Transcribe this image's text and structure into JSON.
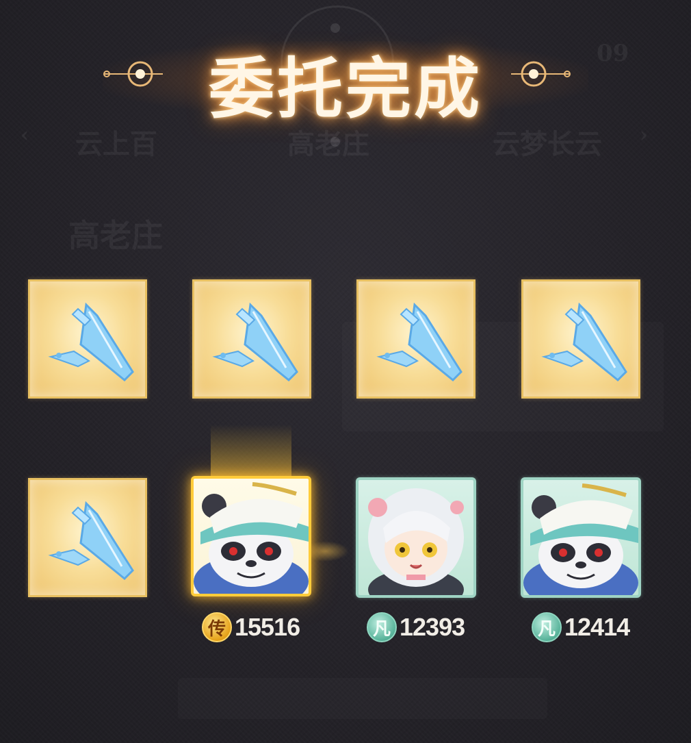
{
  "title": "委托完成",
  "background_ghost": {
    "counter": "09",
    "nav_left": "云上百",
    "nav_center": "高老庄",
    "nav_right": "云梦长云",
    "section": "高老庄"
  },
  "reward_items": [
    {
      "name": "crystal-fan-reward",
      "icon": "crystal-feather-icon"
    },
    {
      "name": "crystal-fan-reward",
      "icon": "crystal-feather-icon"
    },
    {
      "name": "crystal-fan-reward",
      "icon": "crystal-feather-icon"
    },
    {
      "name": "crystal-fan-reward",
      "icon": "crystal-feather-icon"
    },
    {
      "name": "crystal-fan-reward",
      "icon": "crystal-feather-icon"
    }
  ],
  "characters": [
    {
      "portrait": "panda-hat-portrait",
      "rank": "传",
      "rank_tier": "legendary",
      "power": "15516",
      "frame_color": "#ffcc3a"
    },
    {
      "portrait": "silver-hair-girl-portrait",
      "rank": "凡",
      "rank_tier": "common",
      "power": "12393",
      "frame_color": "#9fd4c4"
    },
    {
      "portrait": "panda-hat-portrait",
      "rank": "凡",
      "rank_tier": "common",
      "power": "12414",
      "frame_color": "#9fd4c4"
    }
  ],
  "colors": {
    "title_glow": "#f0a050",
    "item_frame": "#e8c061",
    "legendary": "#e6a21a",
    "common": "#58b39a"
  }
}
